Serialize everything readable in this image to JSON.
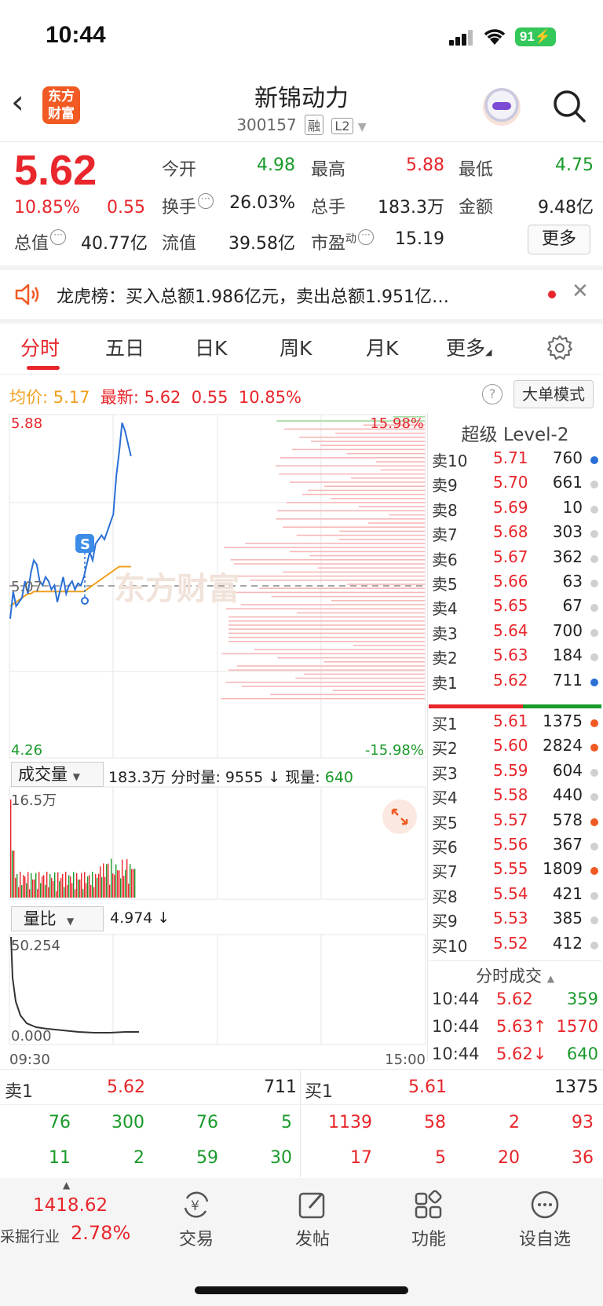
{
  "status": {
    "time": "10:44",
    "battery": "91"
  },
  "header": {
    "name": "新锦动力",
    "code": "300157",
    "tag_rong": "融",
    "tag_l2": "L2",
    "logo": [
      "东方",
      "财富"
    ]
  },
  "quote": {
    "price": "5.62",
    "pct": "10.85%",
    "chg": "0.55",
    "open_label": "今开",
    "open": "4.98",
    "high_label": "最高",
    "high": "5.88",
    "low_label": "最低",
    "low": "4.75",
    "turnover_label": "换手",
    "turnover": "26.03%",
    "volume_label": "总手",
    "volume": "183.3万",
    "amount_label": "金额",
    "amount": "9.48亿",
    "mktcap_label": "总值",
    "mktcap": "40.77亿",
    "float_label": "流值",
    "float": "39.58亿",
    "pe_label": "市盈",
    "pe_sup": "动",
    "pe": "15.19",
    "more": "更多"
  },
  "notice": {
    "text": "龙虎榜：买入总额1.986亿元，卖出总额1.951亿…"
  },
  "tabs": [
    "分时",
    "五日",
    "日K",
    "周K",
    "月K",
    "更多"
  ],
  "info_line": {
    "avg_label": "均价:",
    "avg": "5.17",
    "last_label": "最新:",
    "last": "5.62",
    "chg": "0.55",
    "pct": "10.85%",
    "help": "?",
    "big_order": "大单模式"
  },
  "chart": {
    "ymax": "5.88",
    "ymid": "5.07",
    "ymin": "4.26",
    "pct_max": "15.98%",
    "pct_min": "-15.98%",
    "marker": "S",
    "watermark": "东方财富",
    "vol_selector": "成交量",
    "vol_total": "183.3万",
    "vol_split_label": "分时量:",
    "vol_split": "9555 ↓",
    "cur_vol_label": "现量:",
    "cur_vol": "640",
    "vol_max": "16.5万",
    "ratio_selector": "量比",
    "ratio": "4.974 ↓",
    "ratio_max": "50.254",
    "ratio_min": "0.000",
    "time_start": "09:30",
    "time_end": "15:00"
  },
  "chart_data": {
    "type": "line",
    "title": "",
    "y_range": [
      4.26,
      5.88
    ],
    "prev_close": 5.07,
    "x_range": [
      "09:30",
      "15:00"
    ],
    "series": [
      {
        "values": [
          4.92,
          5.05,
          4.98,
          5.0,
          5.02,
          5.1,
          5.04,
          5.14,
          5.2,
          5.18,
          5.1,
          5.08,
          5.12,
          5.1,
          5.06,
          5.08,
          5.0,
          5.06,
          5.12,
          5.04,
          5.08,
          5.1,
          5.06,
          5.09,
          5.08,
          5.12,
          5.18,
          5.24,
          5.2,
          5.28,
          5.3,
          5.32,
          5.3,
          5.34,
          5.38,
          5.42,
          5.6,
          5.72,
          5.86,
          5.82,
          5.76,
          5.7
        ]
      },
      {
        "values": [
          4.98,
          4.99,
          5.0,
          5.01,
          5.02,
          5.03,
          5.04,
          5.04,
          5.05,
          5.05,
          5.05,
          5.05,
          5.05,
          5.05,
          5.05,
          5.05,
          5.05,
          5.05,
          5.05,
          5.05,
          5.05,
          5.05,
          5.05,
          5.05,
          5.05,
          5.05,
          5.06,
          5.07,
          5.08,
          5.09,
          5.1,
          5.11,
          5.12,
          5.13,
          5.14,
          5.15,
          5.16,
          5.17,
          5.17,
          5.17,
          5.17,
          5.17
        ]
      }
    ]
  },
  "order_book": {
    "title": "超级 Level-2",
    "asks": [
      {
        "label": "卖10",
        "price": "5.71",
        "vol": "760",
        "dot": "#2a6fd6"
      },
      {
        "label": "卖9",
        "price": "5.70",
        "vol": "661",
        "dot": "#d0d0d0"
      },
      {
        "label": "卖8",
        "price": "5.69",
        "vol": "10",
        "dot": "#d0d0d0"
      },
      {
        "label": "卖7",
        "price": "5.68",
        "vol": "303",
        "dot": "#d0d0d0"
      },
      {
        "label": "卖6",
        "price": "5.67",
        "vol": "362",
        "dot": "#d0d0d0"
      },
      {
        "label": "卖5",
        "price": "5.66",
        "vol": "63",
        "dot": "#d0d0d0"
      },
      {
        "label": "卖4",
        "price": "5.65",
        "vol": "67",
        "dot": "#d0d0d0"
      },
      {
        "label": "卖3",
        "price": "5.64",
        "vol": "700",
        "dot": "#d0d0d0"
      },
      {
        "label": "卖2",
        "price": "5.63",
        "vol": "184",
        "dot": "#d0d0d0"
      },
      {
        "label": "卖1",
        "price": "5.62",
        "vol": "711",
        "dot": "#2a6fd6"
      }
    ],
    "bids": [
      {
        "label": "买1",
        "price": "5.61",
        "vol": "1375",
        "dot": "#f05a22"
      },
      {
        "label": "买2",
        "price": "5.60",
        "vol": "2824",
        "dot": "#f05a22"
      },
      {
        "label": "买3",
        "price": "5.59",
        "vol": "604",
        "dot": "#d0d0d0"
      },
      {
        "label": "买4",
        "price": "5.58",
        "vol": "440",
        "dot": "#d0d0d0"
      },
      {
        "label": "买5",
        "price": "5.57",
        "vol": "578",
        "dot": "#f05a22"
      },
      {
        "label": "买6",
        "price": "5.56",
        "vol": "367",
        "dot": "#d0d0d0"
      },
      {
        "label": "买7",
        "price": "5.55",
        "vol": "1809",
        "dot": "#f05a22"
      },
      {
        "label": "买8",
        "price": "5.54",
        "vol": "421",
        "dot": "#d0d0d0"
      },
      {
        "label": "买9",
        "price": "5.53",
        "vol": "385",
        "dot": "#d0d0d0"
      },
      {
        "label": "买10",
        "price": "5.52",
        "vol": "412",
        "dot": "#d0d0d0"
      }
    ]
  },
  "trades": {
    "title": "分时成交",
    "rows": [
      {
        "time": "10:44",
        "price": "5.62",
        "vol": "359",
        "pc": "red",
        "vc": "green"
      },
      {
        "time": "10:44",
        "price": "5.63↑",
        "vol": "1570",
        "pc": "red",
        "vc": "red"
      },
      {
        "time": "10:44",
        "price": "5.62↓",
        "vol": "640",
        "pc": "red",
        "vc": "green"
      }
    ]
  },
  "levels": {
    "sell_label": "卖1",
    "sell_price": "5.62",
    "sell_vol": "711",
    "buy_label": "买1",
    "buy_price": "5.61",
    "buy_vol": "1375",
    "sell_row1": [
      "76",
      "300",
      "76",
      "5"
    ],
    "sell_row2": [
      "11",
      "2",
      "59",
      "30"
    ],
    "buy_row1": [
      "1139",
      "58",
      "2",
      "93"
    ],
    "buy_row2": [
      "17",
      "5",
      "20",
      "36"
    ]
  },
  "bottom_nav": {
    "index_value": "1418.62",
    "industry": "采掘行业",
    "industry_pct": "2.78%",
    "items": [
      "交易",
      "发帖",
      "功能",
      "设自选"
    ]
  },
  "colors": {
    "up": "#e8262b",
    "down": "#1a9a2a",
    "avg": "#f0a020",
    "line": "#2a6fd6",
    "accent": "#f15a22"
  }
}
